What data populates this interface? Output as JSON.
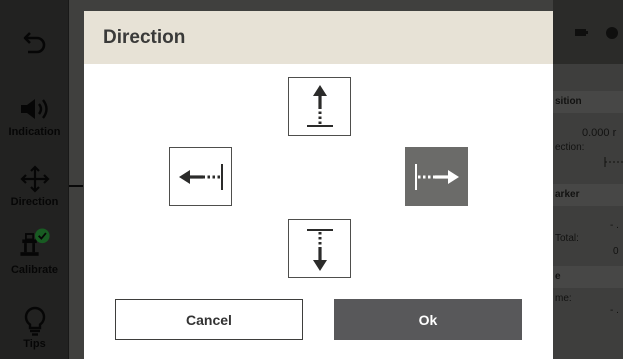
{
  "sidebar": {
    "items": [
      {
        "label": "",
        "icon": "back-arrow-icon"
      },
      {
        "label": "Indication",
        "icon": "speaker-icon"
      },
      {
        "label": "Direction",
        "icon": "move-arrows-icon"
      },
      {
        "label": "Calibrate",
        "icon": "calibrate-check-icon"
      },
      {
        "label": "Tips",
        "icon": "lightbulb-icon"
      }
    ]
  },
  "background_panel": {
    "position_header": "sition",
    "position_value": "0.000 r",
    "direction_label": "ection:",
    "marker_header": "arker",
    "total_label": "Total:",
    "total_value_1": "- .",
    "total_value_2": "0",
    "time_header": "e",
    "time_label": "me:",
    "time_value": "- ."
  },
  "dialog": {
    "title": "Direction",
    "options": [
      {
        "name": "up",
        "icon": "arrow-up-from-line-icon",
        "selected": false
      },
      {
        "name": "left",
        "icon": "arrow-left-from-line-icon",
        "selected": false
      },
      {
        "name": "right",
        "icon": "arrow-right-from-line-icon",
        "selected": true
      },
      {
        "name": "down",
        "icon": "arrow-down-from-line-icon",
        "selected": false
      }
    ],
    "cancel_label": "Cancel",
    "ok_label": "Ok"
  },
  "colors": {
    "header_bg": "#e7e2d6",
    "selected_bg": "#6b6b69",
    "ok_bg": "#58585a",
    "check_green": "#2a9d3b"
  }
}
